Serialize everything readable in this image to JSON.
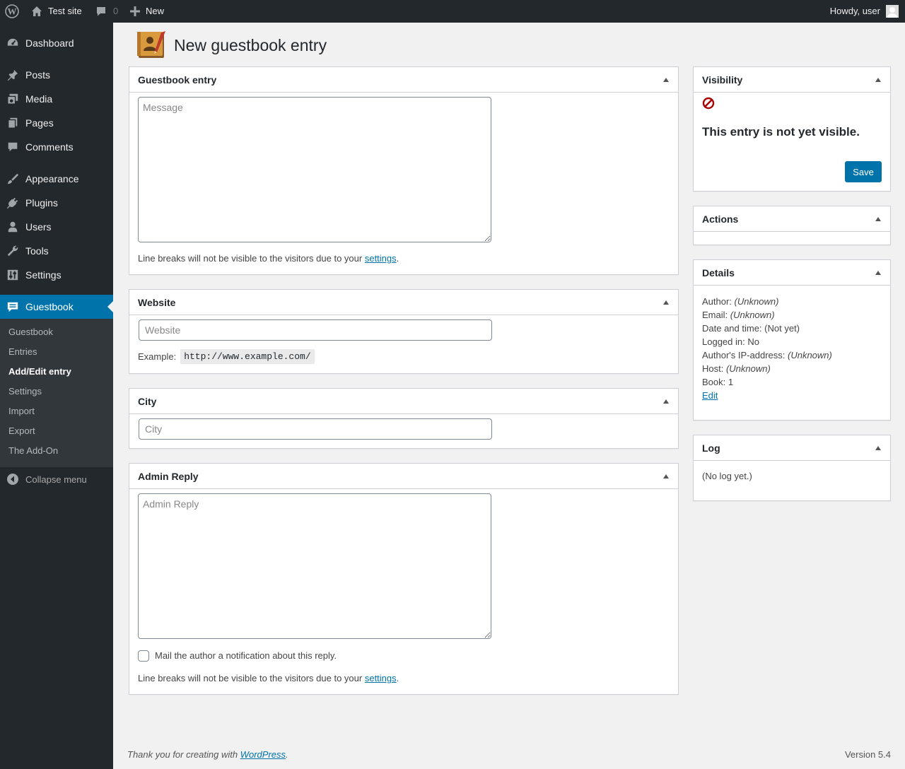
{
  "admin_bar": {
    "site_name": "Test site",
    "comments_count": "0",
    "new_label": "New",
    "howdy": "Howdy, user"
  },
  "sidebar": {
    "items": [
      {
        "label": "Dashboard",
        "icon": "dashboard-icon"
      },
      {
        "label": "Posts",
        "icon": "pin-icon"
      },
      {
        "label": "Media",
        "icon": "media-icon"
      },
      {
        "label": "Pages",
        "icon": "pages-icon"
      },
      {
        "label": "Comments",
        "icon": "comment-bubble-icon"
      },
      {
        "label": "Appearance",
        "icon": "brush-icon"
      },
      {
        "label": "Plugins",
        "icon": "plug-icon"
      },
      {
        "label": "Users",
        "icon": "user-icon"
      },
      {
        "label": "Tools",
        "icon": "wrench-icon"
      },
      {
        "label": "Settings",
        "icon": "sliders-icon"
      },
      {
        "label": "Guestbook",
        "icon": "guestbook-icon"
      }
    ],
    "submenu": [
      "Guestbook",
      "Entries",
      "Add/Edit entry",
      "Settings",
      "Import",
      "Export",
      "The Add-On"
    ],
    "collapse_label": "Collapse menu"
  },
  "page": {
    "title": "New guestbook entry"
  },
  "guestbook_entry_box": {
    "title": "Guestbook entry",
    "message_placeholder": "Message",
    "note_prefix": "Line breaks will not be visible to the visitors due to your ",
    "note_link": "settings",
    "note_suffix": "."
  },
  "website_box": {
    "title": "Website",
    "placeholder": "Website",
    "example_label": "Example:",
    "example_value": "http://www.example.com/"
  },
  "city_box": {
    "title": "City",
    "placeholder": "City"
  },
  "admin_reply_box": {
    "title": "Admin Reply",
    "placeholder": "Admin Reply",
    "mail_label": "Mail the author a notification about this reply.",
    "note_prefix": "Line breaks will not be visible to the visitors due to your ",
    "note_link": "settings",
    "note_suffix": "."
  },
  "visibility_box": {
    "title": "Visibility",
    "status": "This entry is not yet visible.",
    "save_label": "Save"
  },
  "actions_box": {
    "title": "Actions"
  },
  "details_box": {
    "title": "Details",
    "author_label": "Author:",
    "author_value": "(Unknown)",
    "email_label": "Email:",
    "email_value": "(Unknown)",
    "date_label": "Date and time:",
    "date_value": "(Not yet)",
    "logged_label": "Logged in:",
    "logged_value": "No",
    "ip_label": "Author's IP-address:",
    "ip_value": "(Unknown)",
    "host_label": "Host:",
    "host_value": "(Unknown)",
    "book_label": "Book:",
    "book_value": "1",
    "edit_label": "Edit"
  },
  "log_box": {
    "title": "Log",
    "content": "(No log yet.)"
  },
  "footer": {
    "thanks_prefix": "Thank you for creating with ",
    "thanks_link": "WordPress",
    "thanks_suffix": ".",
    "version": "Version 5.4"
  }
}
